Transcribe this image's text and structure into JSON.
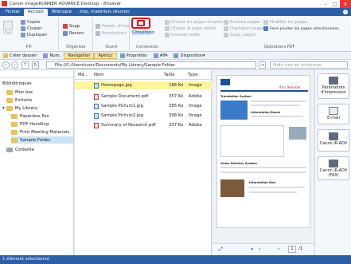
{
  "window": {
    "title": "Canon imageRUNNER ADVANCE Desktop - Browser"
  },
  "menu_tabs": [
    "Fichier",
    "Accueil",
    "Télécopie",
    "Imp. matériels réunion"
  ],
  "ribbon": {
    "pp_group": {
      "label": "P.P.",
      "coll": "Coll",
      "copier": "Copier",
      "couper": "Couper",
      "dupliquer": "Dupliquer"
    },
    "organiser_group": {
      "label": "Organiser",
      "supp": "Supp.",
      "renom": "Renom."
    },
    "ouvrir_group": {
      "label": "Ouvrir",
      "param_imp": "Param. d'imp.",
      "annotations": "Annotations"
    },
    "conversion_group": {
      "label": "Conversion",
      "convert_button": "Conversion"
    },
    "ops_group": {
      "label": "Opérations PDF",
      "diviser_simples": "Diviser en pages simples",
      "diviser_select": "Diviser la page sélect.",
      "inverser": "Inverser ordre",
      "extraire": "Extraire pages",
      "dupliquer_pages": "Dupliquer pages",
      "supp_pages": "Supp. pages",
      "modifier": "Modifier les pages",
      "pivoter": "Faire pivoter les pages sélectionnées"
    }
  },
  "toolbar": {
    "creer": "Créer dossier",
    "num": "Num.",
    "navigation": "Navigation",
    "apercu": "Aperçu",
    "proprietes": "Propriétés",
    "aff": "Aff",
    "disposition": "Disposition"
  },
  "address": {
    "path": "File://C:/Users/user/Documents/My Library/Sample Folder",
    "search_placeholder": "Mots clés de recherche"
  },
  "tree": {
    "header": "Bibliothèques",
    "items": [
      "Mon bac",
      "Extraire",
      "My Library",
      "Paperless Fax",
      "PDF Handling",
      "Print Meeting Materials",
      "Sample Folder",
      "Corbeille"
    ]
  },
  "filelist": {
    "columns": {
      "me": "Mé...",
      "nom": "Nom",
      "taille": "Taille",
      "type": "Type"
    },
    "rows": [
      {
        "name": "Homepage.jpg",
        "size": "186 Ko",
        "type": "Image"
      },
      {
        "name": "Sample Document.pdf",
        "size": "357 Ko",
        "type": "Adobe"
      },
      {
        "name": "Sample Picture1.jpg",
        "size": "385 Ko",
        "type": "Image"
      },
      {
        "name": "Sample Picture2.jpg",
        "size": "398 Ko",
        "type": "Image"
      },
      {
        "name": "Summary of Research.pdf",
        "size": "337 Ko",
        "type": "Adobe"
      }
    ]
  },
  "preview": {
    "heading": "Au's Services",
    "sec1": "Translation System",
    "sec2": "Information Board",
    "sec3": "Order Delivery System",
    "sec4": "Information Doll",
    "page_num": "1",
    "page_total": "/1"
  },
  "right_panel": {
    "btn1": "Paramètres d'impression",
    "btn2": "E-mail",
    "btn3": "Canon iR-ADV",
    "btn4": "Canon iR-ADV (FAX)"
  },
  "status": {
    "text": "1 élément sélectionné"
  }
}
